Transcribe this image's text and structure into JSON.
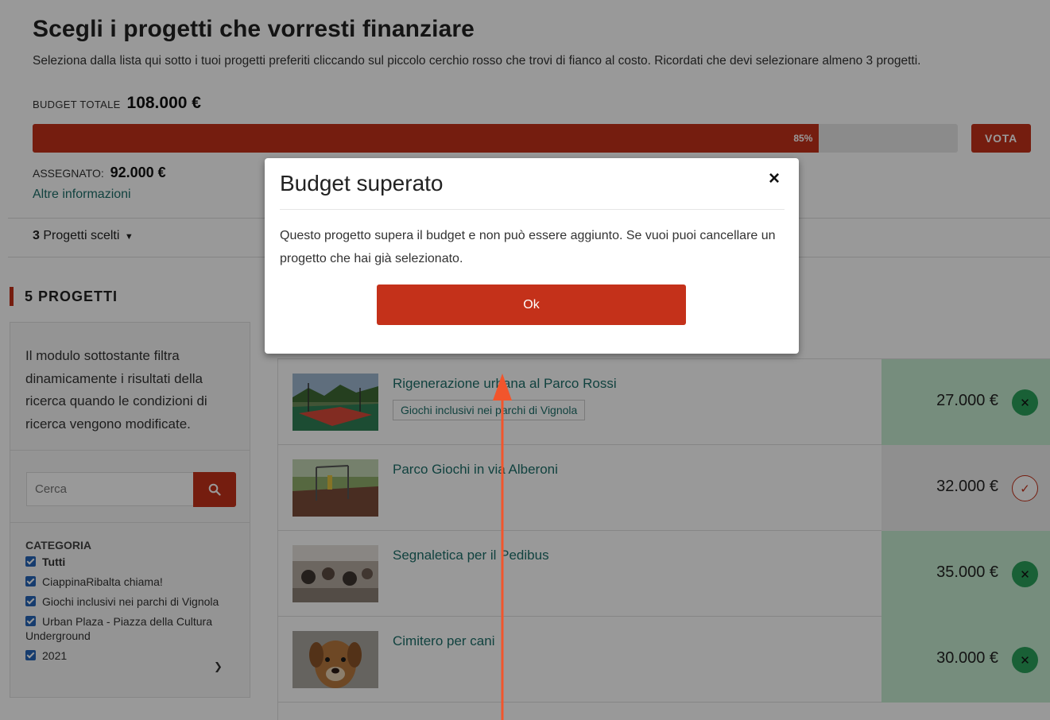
{
  "header": {
    "title": "Scegli i progetti che vorresti finanziare",
    "subtitle": "Seleziona dalla lista qui sotto i tuoi progetti preferiti cliccando sul piccolo cerchio rosso che trovi di fianco al costo. Ricordati che devi selezionare almeno 3 progetti.",
    "budget_label": "Budget totale",
    "budget_value": "108.000 €",
    "progress_percent": 85,
    "progress_label": "85%",
    "vota_label": "VOTA",
    "assigned_label": "Assegnato:",
    "assigned_value": "92.000 €",
    "info_link": "Altre informazioni",
    "selected_count": "3",
    "selected_label": " Progetti scelti"
  },
  "sidebar": {
    "projects_count_title": "5 PROGETTI",
    "description": "Il modulo sottostante filtra dinamicamente i risultati della ricerca quando le condizioni di ricerca vengono modificate.",
    "search_placeholder": "Cerca",
    "category_title": "Categoria",
    "categories": [
      {
        "label": "Tutti",
        "checked": true
      },
      {
        "label": "CiappinaRibalta chiama!",
        "checked": true
      },
      {
        "label": "Giochi inclusivi nei parchi di Vignola",
        "checked": true
      },
      {
        "label": "Urban Plaza - Piazza della Cultura Underground",
        "checked": true
      },
      {
        "label": "2021",
        "checked": true
      }
    ]
  },
  "projects": [
    {
      "name": "Rigenerazione urbana al Parco Rossi",
      "tag": "Giochi inclusivi nei parchi di Vignola",
      "price": "27.000 €",
      "selected": true
    },
    {
      "name": "Parco Giochi in via Alberoni",
      "tag": "",
      "price": "32.000 €",
      "selected": false
    },
    {
      "name": "Segnaletica per il Pedibus",
      "tag": "",
      "price": "35.000 €",
      "selected": true
    },
    {
      "name": "Cimitero per cani",
      "tag": "",
      "price": "30.000 €",
      "selected": true
    }
  ],
  "modal": {
    "title": "Budget superato",
    "body": "Questo progetto supera il budget e non può essere aggiunto. Se vuoi puoi cancellare un progetto che hai già selezionato.",
    "ok_label": "Ok",
    "close_glyph": "×"
  },
  "colors": {
    "accent": "#c4311a",
    "link": "#1d6f6a",
    "selected_bg": "#c5ecd1",
    "annotation_arrow": "#f2552c"
  },
  "icons": {
    "search": "search-icon",
    "close": "close-icon",
    "remove": "remove-icon",
    "add": "check-icon",
    "caret": "caret-down-icon"
  }
}
